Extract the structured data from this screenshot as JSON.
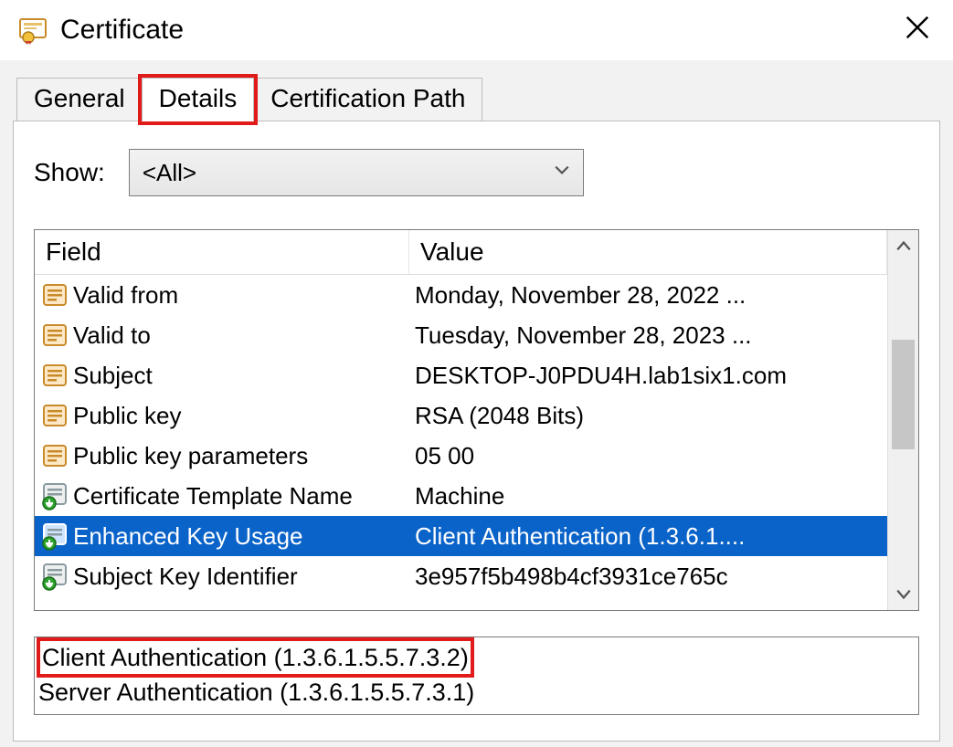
{
  "window": {
    "title": "Certificate"
  },
  "tabs": {
    "general": "General",
    "details": "Details",
    "cert_path": "Certification Path"
  },
  "show": {
    "label": "Show:",
    "value": "<All>"
  },
  "columns": {
    "field": "Field",
    "value": "Value"
  },
  "rows": [
    {
      "icon": "prop",
      "field": "Valid from",
      "value": "Monday, November 28, 2022 ..."
    },
    {
      "icon": "prop",
      "field": "Valid to",
      "value": "Tuesday, November 28, 2023 ..."
    },
    {
      "icon": "prop",
      "field": "Subject",
      "value": "DESKTOP-J0PDU4H.lab1six1.com"
    },
    {
      "icon": "prop",
      "field": "Public key",
      "value": "RSA (2048 Bits)"
    },
    {
      "icon": "prop",
      "field": "Public key parameters",
      "value": "05 00"
    },
    {
      "icon": "ext",
      "field": "Certificate Template Name",
      "value": "Machine"
    },
    {
      "icon": "ext",
      "field": "Enhanced Key Usage",
      "value": "Client Authentication (1.3.6.1...."
    },
    {
      "icon": "ext",
      "field": "Subject Key Identifier",
      "value": "3e957f5b498b4cf3931ce765c"
    }
  ],
  "selected_index": 6,
  "details_text": {
    "line1": "Client Authentication (1.3.6.1.5.5.7.3.2)",
    "line2": "Server Authentication (1.3.6.1.5.5.7.3.1)"
  }
}
